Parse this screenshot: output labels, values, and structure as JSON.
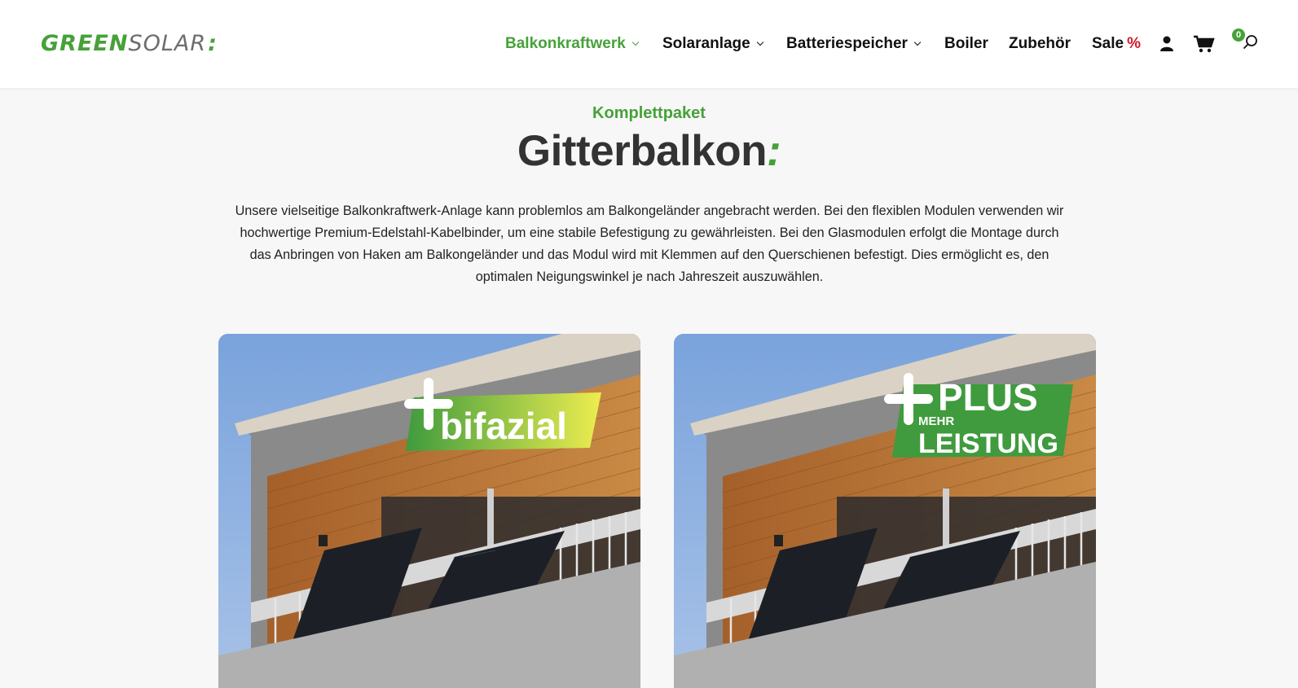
{
  "brand": {
    "green": "GREEN",
    "solar": "SOLAR",
    "mark": ":"
  },
  "nav": {
    "items": [
      {
        "label": "Balkonkraftwerk",
        "active": true,
        "has_dropdown": true
      },
      {
        "label": "Solaranlage",
        "active": false,
        "has_dropdown": true
      },
      {
        "label": "Batteriespeicher",
        "active": false,
        "has_dropdown": true
      },
      {
        "label": "Boiler",
        "active": false,
        "has_dropdown": false
      },
      {
        "label": "Zubehör",
        "active": false,
        "has_dropdown": false
      },
      {
        "label": "Sale",
        "suffix": "%",
        "active": false,
        "has_dropdown": false
      }
    ],
    "icons": [
      "user-icon",
      "cart-icon",
      "search-icon"
    ],
    "cart_count": "0"
  },
  "content": {
    "eyebrow": "Komplettpaket",
    "title": "Gitterbalkon",
    "title_mark": ":",
    "description": "Unsere vielseitige Balkonkraftwerk-Anlage kann problemlos am Balkongeländer angebracht werden. Bei den flexiblen Modulen verwenden wir hochwertige Premium-Edelstahl-Kabelbinder, um eine stabile Befestigung zu gewährleisten. Bei den Glasmodulen erfolgt die Montage durch das Anbringen von Haken am Balkongeländer und das Modul wird mit Klemmen auf den Querschienen befestigt. Dies ermöglicht es, den optimalen Neigungswinkel je nach Jahreszeit auszuwählen."
  },
  "cards": [
    {
      "badge_main": "bifazial",
      "badge_colors": [
        "#3f9b3d",
        "#eded4f"
      ]
    },
    {
      "badge_main": "PLUS",
      "badge_small": "MEHR",
      "badge_sub": "LEISTUNG",
      "badge_colors": [
        "#3f9b3d",
        "#3f9b3d"
      ]
    }
  ],
  "colors": {
    "accent": "#46a139",
    "sale": "#d0192a",
    "text": "#333333",
    "background": "#f7f7f7"
  }
}
